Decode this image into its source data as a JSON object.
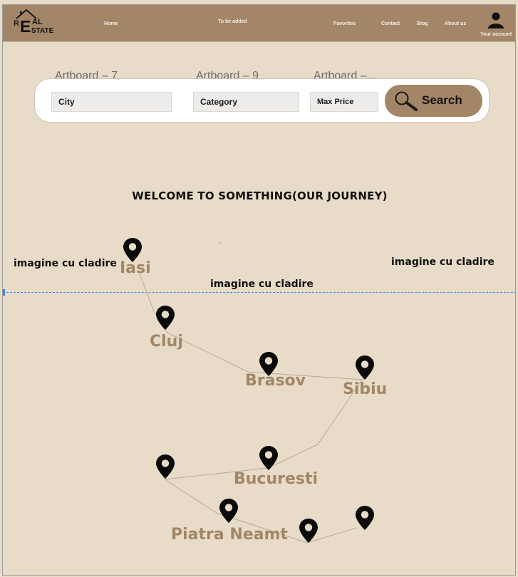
{
  "header": {
    "logo": {
      "r": "R",
      "e": "E",
      "al": "AL",
      "state": "STATE"
    },
    "nav": {
      "home": "Home",
      "to_be_added": "To be added",
      "favorites": "Favorites",
      "contact": "Contact",
      "blog": "Blog",
      "about": "About us"
    },
    "account_label": "Your account",
    "account_icon": "user-icon"
  },
  "search": {
    "artboard_labels": [
      "Artboard – 7",
      "Artboard – 9",
      "Artboard –..."
    ],
    "city_placeholder": "City",
    "category_placeholder": "Category",
    "max_price_placeholder": "Max Price",
    "button_label": "Search",
    "button_icon": "magnifier-icon"
  },
  "main": {
    "welcome": "WELCOME TO SOMETHING(OUR JOURNEY)",
    "image_placeholders": [
      "imagine cu cladire",
      "imagine cu cladire",
      "imagine cu cladire"
    ],
    "cities": [
      "Iasi",
      "Cluj",
      "Brasov",
      "Sibiu",
      "Bucuresti",
      "Piatra Neamt"
    ]
  },
  "colors": {
    "brand": "#a38667",
    "background": "#e8dcc8",
    "guide": "#3b82f6"
  }
}
